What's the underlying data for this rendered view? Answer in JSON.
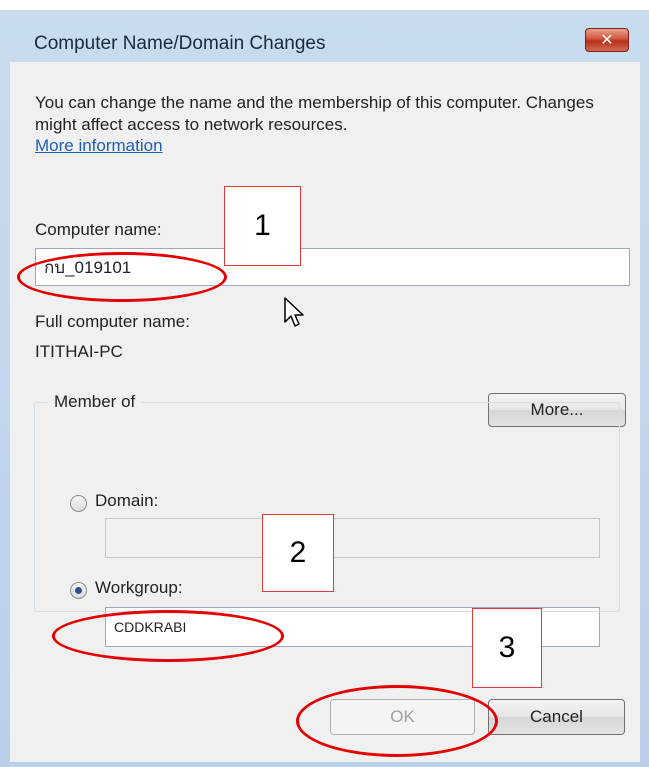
{
  "dialog": {
    "title": "Computer Name/Domain Changes",
    "close_icon": "close-icon",
    "description": "You can change the name and the membership of this computer. Changes might affect access to network resources.",
    "more_info_link": "More information",
    "computer_name_label": "Computer name:",
    "computer_name_value": "กบ_019101",
    "full_name_label": "Full computer name:",
    "full_name_value": "ITITHAI-PC",
    "more_button": "More...",
    "member_of_label": "Member of",
    "domain_label": "Domain:",
    "domain_value": "",
    "workgroup_label": "Workgroup:",
    "workgroup_value": "CDDKRABI",
    "selected_membership": "Workgroup",
    "ok_button": "OK",
    "cancel_button": "Cancel"
  },
  "annotations": {
    "step1": "1",
    "step2": "2",
    "step3": "3",
    "highlight_color": "#e40000"
  }
}
